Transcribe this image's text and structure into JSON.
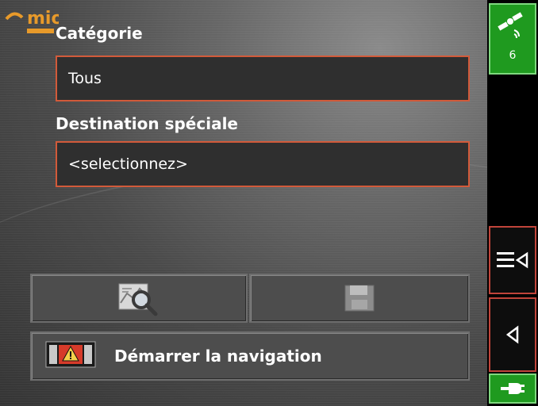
{
  "brand": {
    "logo_text": "mio"
  },
  "category": {
    "label": "Catégorie",
    "value": "Tous"
  },
  "destination": {
    "label": "Destination spéciale",
    "value": "<selectionnez>"
  },
  "actions": {
    "search_icon": "map-search-icon",
    "save_icon": "floppy-disk-icon",
    "start_label": "Démarrer la navigation",
    "start_icon": "route-flag-icon"
  },
  "sidebar": {
    "gps": {
      "icon": "satellite-icon",
      "count": "6"
    },
    "menu_icon": "list-menu-icon",
    "back_icon": "back-arrow-icon",
    "power_icon": "power-plug-icon"
  },
  "colors": {
    "field_border": "#d25a3a",
    "status_green": "#1f9a1f",
    "sidebar_border": "#c0443a"
  }
}
